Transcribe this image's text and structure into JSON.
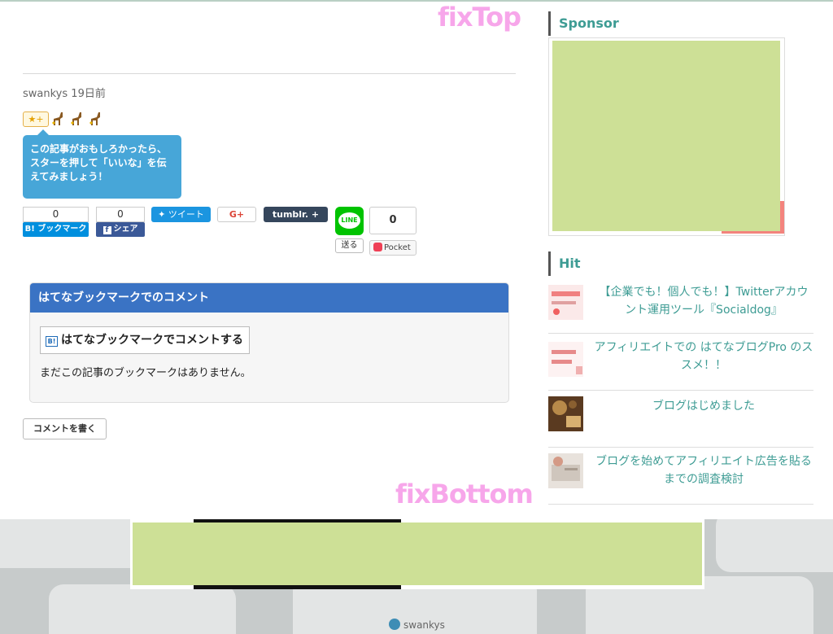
{
  "markers": {
    "fix_top": "fixTop",
    "fix_bottom": "fixBottom"
  },
  "entry": {
    "author": "swankys",
    "time_ago": "19日前",
    "star_add_label": "★+",
    "star_tooltip": "この記事がおもしろかったら、スターを押して「いいな」を伝えてみましょう！"
  },
  "share": {
    "hatena_count": "0",
    "hatena_label": "B! ブックマーク",
    "facebook_count": "0",
    "facebook_label": "シェア",
    "tweet_label": "ツイート",
    "gplus_label": "G+",
    "tumblr_label": "tumblr. +",
    "line_icon_text": "LINE",
    "line_send_label": "送る",
    "pocket_count": "0",
    "pocket_label": "Pocket"
  },
  "comments": {
    "panel_title": "はてなブックマークでのコメント",
    "bookmark_icon_text": "B!",
    "comment_button": "はてなブックマークでコメントする",
    "empty_message": "まだこの記事のブックマークはありません。",
    "write_button": "コメントを書く"
  },
  "sidebar": {
    "sponsor_title": "Sponsor",
    "hit_title": "Hit",
    "hit_items": [
      {
        "title": "【企業でも！個人でも！】Twitterアカウント運用ツール『Socialdog』"
      },
      {
        "title": "アフィリエイトでの はてなブログPro のススメ！！"
      },
      {
        "title": "ブログはじめました"
      },
      {
        "title": "ブログを始めてアフィリエイト広告を貼るまでの調査検討"
      }
    ]
  },
  "footer": {
    "brand": "swankys"
  },
  "colors": {
    "accent_teal": "#3e9c94",
    "tweet_blue": "#1b95e0",
    "hatena_blue": "#008fde",
    "facebook_blue": "#3b5998",
    "line_green": "#00c300",
    "ad_green": "#cde096",
    "marker_pink": "#f7a6ea"
  }
}
